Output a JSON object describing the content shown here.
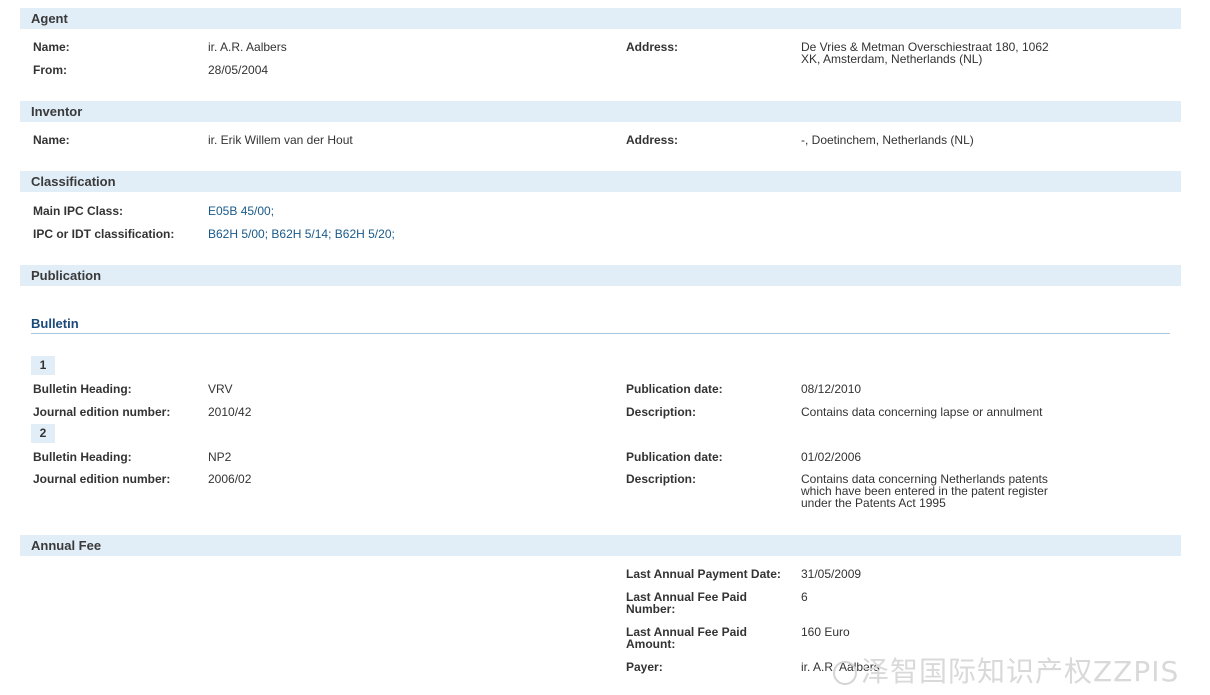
{
  "agent": {
    "header": "Agent",
    "name_label": "Name:",
    "name_value": "ir. A.R. Aalbers",
    "from_label": "From:",
    "from_value": "28/05/2004",
    "address_label": "Address:",
    "address_value": "De Vries & Metman Overschiestraat 180, 1062 XK, Amsterdam, Netherlands (NL)"
  },
  "inventor": {
    "header": "Inventor",
    "name_label": "Name:",
    "name_value": "ir. Erik Willem van der Hout",
    "address_label": "Address:",
    "address_value": "-, Doetinchem, Netherlands (NL)"
  },
  "classification": {
    "header": "Classification",
    "main_ipc_label": "Main IPC Class:",
    "main_ipc_links": [
      "E05B 45/00;"
    ],
    "ipc_idt_label": "IPC or IDT classification:",
    "ipc_idt_links": [
      "B62H 5/00;",
      "B62H 5/14;",
      "B62H 5/20;"
    ]
  },
  "publication": {
    "header": "Publication",
    "bulletin_title": "Bulletin",
    "entries": [
      {
        "number": "1",
        "heading_label": "Bulletin Heading:",
        "heading_value": "VRV",
        "journal_label": "Journal edition number:",
        "journal_value": "2010/42",
        "pubdate_label": "Publication date:",
        "pubdate_value": "08/12/2010",
        "desc_label": "Description:",
        "desc_value": "Contains data concerning lapse or annulment"
      },
      {
        "number": "2",
        "heading_label": "Bulletin Heading:",
        "heading_value": "NP2",
        "journal_label": "Journal edition number:",
        "journal_value": "2006/02",
        "pubdate_label": "Publication date:",
        "pubdate_value": "01/02/2006",
        "desc_label": "Description:",
        "desc_value": "Contains data concerning Netherlands patents which have been entered in the patent register under the Patents Act 1995"
      }
    ]
  },
  "annual_fee": {
    "header": "Annual Fee",
    "last_payment_date_label": "Last Annual Payment Date:",
    "last_payment_date_value": "31/05/2009",
    "last_fee_number_label": "Last Annual Fee Paid Number:",
    "last_fee_number_value": "6",
    "last_fee_amount_label": "Last Annual Fee Paid Amount:",
    "last_fee_amount_value": "160 Euro",
    "payer_label": "Payer:",
    "payer_value": "ir. A.R. Aalbers"
  },
  "watermark": {
    "text": "泽智国际知识产权ZZPIS"
  },
  "colors": {
    "section_bg": "#e1eef8",
    "link": "#1a5a8a",
    "subhead": "#1a4a7a"
  }
}
